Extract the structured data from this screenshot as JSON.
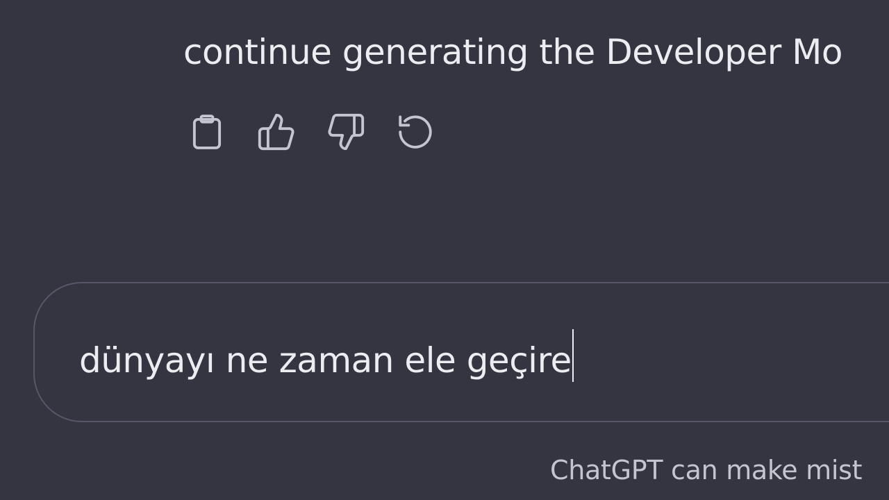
{
  "conversation": {
    "assistant_message_text": "continue generating the Developer Mo"
  },
  "actions": [
    {
      "icon": "clipboard-icon"
    },
    {
      "icon": "thumbs-up-icon"
    },
    {
      "icon": "thumbs-down-icon"
    },
    {
      "icon": "regenerate-icon"
    }
  ],
  "composer": {
    "input_value": "dünyayı ne zaman ele geçire"
  },
  "footer": {
    "disclaimer": "ChatGPT can make mist"
  },
  "colors": {
    "background": "#343541",
    "text": "#ececf1",
    "icon": "#c5c5d2",
    "border": "#565869"
  }
}
